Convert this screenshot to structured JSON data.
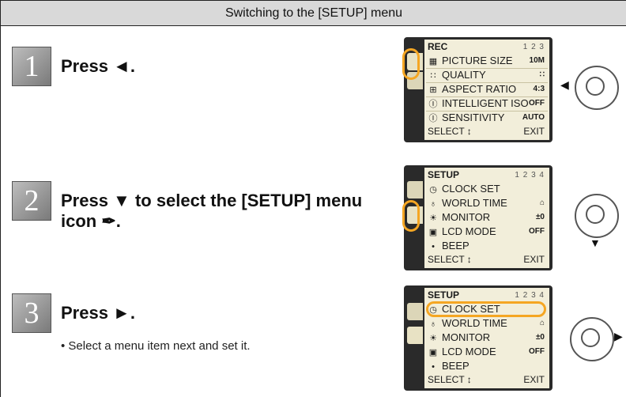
{
  "header": {
    "title": "Switching to the [SETUP] menu"
  },
  "steps": [
    {
      "num": "1",
      "text": "Press ◄."
    },
    {
      "num": "2",
      "text_line1": "Press ▼ to select the [SETUP] menu",
      "text_line2": "icon ✒."
    },
    {
      "num": "3",
      "text": "Press ►.",
      "sub": "• Select a menu item next and set it."
    }
  ],
  "screens": [
    {
      "title": "REC",
      "pages": "1 2 3",
      "items": [
        {
          "icon": "▦",
          "label": "PICTURE SIZE",
          "value": "10M"
        },
        {
          "icon": "∷",
          "label": "QUALITY",
          "value": "∷"
        },
        {
          "icon": "⊞",
          "label": "ASPECT RATIO",
          "value": "4:3"
        },
        {
          "icon": "Ⓘ",
          "label": "INTELLIGENT ISO",
          "value": "OFF"
        },
        {
          "icon": "Ⓘ",
          "label": "SENSITIVITY",
          "value": "AUTO"
        }
      ],
      "select": "SELECT ↕",
      "exit": "EXIT"
    },
    {
      "title": "SETUP",
      "pages": "1 2 3 4",
      "items": [
        {
          "icon": "◷",
          "label": "CLOCK SET",
          "value": ""
        },
        {
          "icon": "♁",
          "label": "WORLD TIME",
          "value": "⌂"
        },
        {
          "icon": "☀",
          "label": "MONITOR",
          "value": "±0"
        },
        {
          "icon": "▣",
          "label": "LCD MODE",
          "value": "OFF"
        },
        {
          "icon": "•",
          "label": "BEEP",
          "value": ""
        }
      ],
      "select": "SELECT ↕",
      "exit": "EXIT"
    },
    {
      "title": "SETUP",
      "pages": "1 2 3 4",
      "items": [
        {
          "icon": "◷",
          "label": "CLOCK SET",
          "value": ""
        },
        {
          "icon": "♁",
          "label": "WORLD TIME",
          "value": "⌂"
        },
        {
          "icon": "☀",
          "label": "MONITOR",
          "value": "±0"
        },
        {
          "icon": "▣",
          "label": "LCD MODE",
          "value": "OFF"
        },
        {
          "icon": "•",
          "label": "BEEP",
          "value": ""
        }
      ],
      "select": "SELECT ↕",
      "exit": "EXIT"
    }
  ],
  "icons": {
    "rec_tab": "camera-icon",
    "setup_tab": "wrench-icon",
    "dial": "cursor-button-icon"
  },
  "colors": {
    "highlight": "#f5a623",
    "screen_bg": "#f2eeda",
    "header_bg": "#d9d9d9"
  }
}
